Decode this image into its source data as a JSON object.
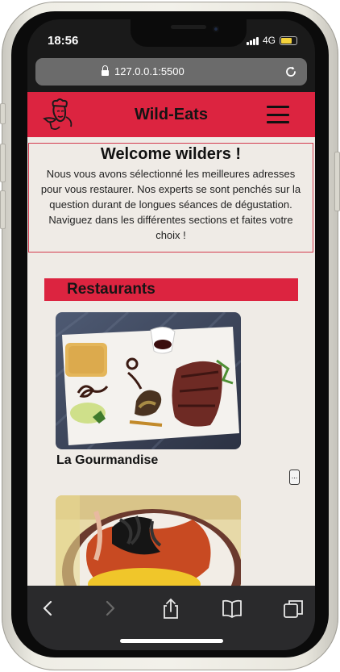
{
  "status_bar": {
    "time": "18:56",
    "network": "4G"
  },
  "browser": {
    "url": "127.0.0.1:5500"
  },
  "site": {
    "brand": "Wild-Eats",
    "welcome_title": "Welcome wilders !",
    "welcome_text": "Nous vous avons sélectionné les meilleures adresses pour vous restaurer. Nos experts se sont penchés sur la question durant de longues séances de dégustation. Naviguez dans les différentes sections et faites votre choix !",
    "section_title": "Restaurants",
    "restaurants": [
      {
        "name": "La Gourmandise",
        "more_label": "..."
      }
    ]
  },
  "colors": {
    "brand_red": "#dc2440",
    "page_bg": "#efebe6"
  },
  "icons": [
    "chef-logo-icon",
    "hamburger-menu-icon",
    "lock-icon",
    "reload-icon",
    "back-icon",
    "forward-icon",
    "share-icon",
    "bookmarks-icon",
    "tabs-icon"
  ]
}
